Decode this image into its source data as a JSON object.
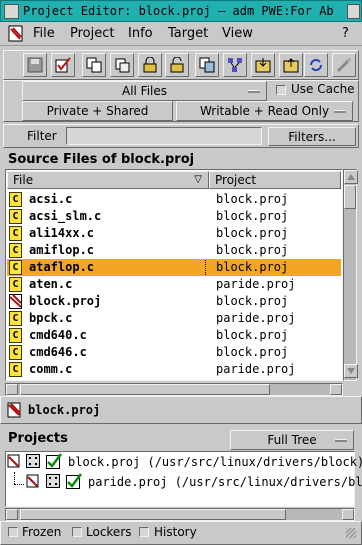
{
  "window": {
    "title": "Project Editor: block.proj – adm PWE:For Ab"
  },
  "menu": {
    "file": "File",
    "project": "Project",
    "info": "Info",
    "target": "Target",
    "view": "View",
    "help": "?"
  },
  "toolbar": {
    "icons": [
      "save-icon",
      "edit-checklist-icon",
      "copy-files-icon",
      "paste-files-icon",
      "lock-icon",
      "unlock-icon",
      "compare-icon",
      "network-icon",
      "import-icon",
      "export-icon",
      "refresh-icon",
      "settings-icon"
    ]
  },
  "filters": {
    "files_mode": "All Files",
    "use_cache": "Use Cache",
    "ownership": "Private + Shared",
    "permission": "Writable + Read Only",
    "filter_label": "Filter",
    "filter_value": "",
    "filters_button": "Filters..."
  },
  "source_files": {
    "title": "Source Files of block.proj",
    "col_file": "File",
    "col_project": "Project",
    "rows": [
      {
        "file": "acsi.c",
        "project": "block.proj",
        "type": "c"
      },
      {
        "file": "acsi_slm.c",
        "project": "block.proj",
        "type": "c"
      },
      {
        "file": "ali14xx.c",
        "project": "block.proj",
        "type": "c"
      },
      {
        "file": "amiflop.c",
        "project": "block.proj",
        "type": "c"
      },
      {
        "file": "ataflop.c",
        "project": "block.proj",
        "type": "c",
        "selected": true
      },
      {
        "file": "aten.c",
        "project": "paride.proj",
        "type": "c"
      },
      {
        "file": "block.proj",
        "project": "block.proj",
        "type": "proj"
      },
      {
        "file": "bpck.c",
        "project": "paride.proj",
        "type": "c"
      },
      {
        "file": "cmd640.c",
        "project": "block.proj",
        "type": "c"
      },
      {
        "file": "cmd646.c",
        "project": "block.proj",
        "type": "c"
      },
      {
        "file": "comm.c",
        "project": "paride.proj",
        "type": "c"
      }
    ]
  },
  "current_project": "block.proj",
  "projects": {
    "title": "Projects",
    "view_mode": "Full Tree",
    "items": [
      {
        "label": "block.proj  (/usr/src/linux/drivers/block)",
        "level": 0
      },
      {
        "label": "paride.proj  (/usr/src/linux/drivers/bl",
        "level": 1
      }
    ]
  },
  "status": {
    "frozen": "Frozen",
    "lockers": "Lockers",
    "history": "History"
  },
  "colors": {
    "titlebar": "#20b0b0",
    "selection": "#f2a622",
    "c_icon": "#ffe23a"
  }
}
